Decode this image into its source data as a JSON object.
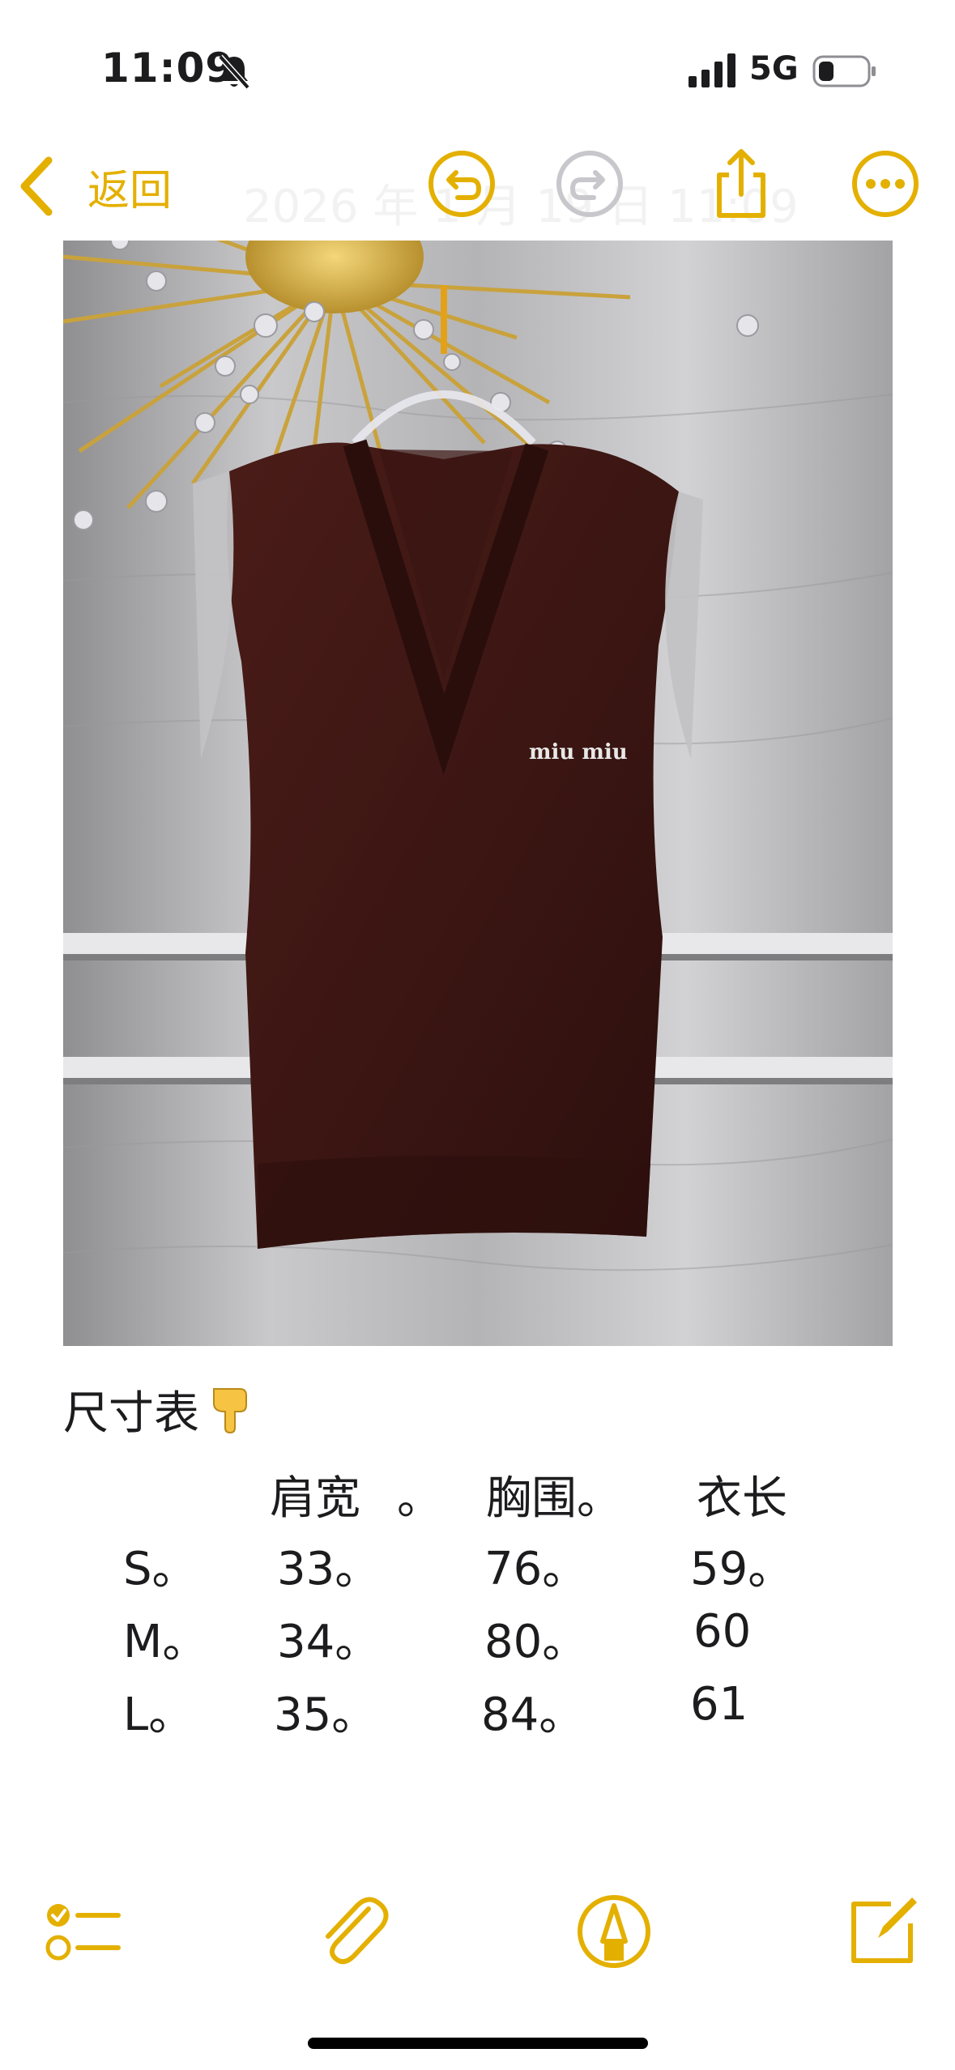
{
  "status_bar": {
    "time": "11:09",
    "network": "5G",
    "icons": [
      "silent-bell-icon",
      "signal-icon",
      "battery-icon"
    ]
  },
  "nav": {
    "back_label": "返回",
    "faded_title": "2026 年 1 月 19 日 11:09",
    "icons": [
      "undo-icon",
      "redo-icon",
      "share-icon",
      "more-icon"
    ],
    "accent_color": "#e4b000"
  },
  "note": {
    "heading": "尺寸表",
    "heading_emoji": "pointing-down-hand-icon",
    "size_table": {
      "headers": [
        "肩宽",
        "。",
        "胸围。",
        "衣长"
      ],
      "rows": [
        {
          "size": "S。",
          "shoulder": "33。",
          "chest": "76。",
          "length": "59。"
        },
        {
          "size": "M。",
          "shoulder": "34。",
          "chest": "80。",
          "length": "60"
        },
        {
          "size": "L。",
          "shoulder": "35。",
          "chest": "84。",
          "length": "61"
        }
      ]
    }
  },
  "toolbar": {
    "icons": [
      "checklist-icon",
      "paperclip-icon",
      "markup-pen-icon",
      "compose-icon"
    ]
  }
}
